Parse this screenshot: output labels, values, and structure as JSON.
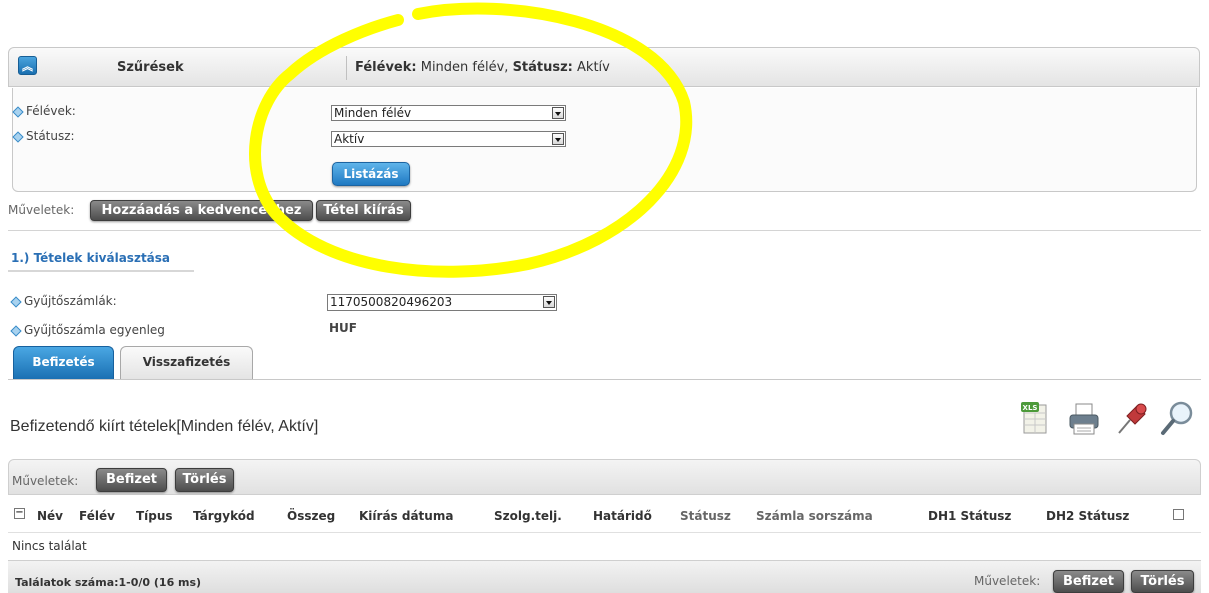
{
  "filters": {
    "title": "Szűrések",
    "summary_semester_label": "Félévek:",
    "summary_semester_value": " Minden félév, ",
    "summary_status_label": "Státusz:",
    "summary_status_value": " Aktív",
    "semester_label": "Félévek:",
    "semester_value": "Minden félév",
    "status_label": "Státusz:",
    "status_value": "Aktív",
    "list_button": "Listázás"
  },
  "operations_top": {
    "label": "Műveletek:",
    "add_favorites": "Hozzáadás a kedvencekhez",
    "print_item": "Tétel kiírás"
  },
  "section": {
    "title": "1.) Tételek kiválasztása",
    "account_label": "Gyűjtőszámlák:",
    "account_value": "1170500820496203",
    "balance_label": "Gyűjtőszámla egyenleg",
    "balance_value": "HUF"
  },
  "tabs": [
    {
      "label": "Befizetés",
      "active": true
    },
    {
      "label": "Visszafizetés",
      "active": false
    }
  ],
  "list": {
    "title": "Befizetendő kiírt tételek[Minden félév, Aktív]",
    "toolbar_icons": [
      "excel-export-icon",
      "print-icon",
      "pin-icon",
      "search-icon"
    ],
    "xls_badge": "XLS"
  },
  "grid": {
    "ops_label": "Műveletek:",
    "pay_button": "Befizet",
    "delete_button": "Törlés",
    "columns": [
      "Név",
      "Félév",
      "Típus",
      "Tárgykód",
      "Összeg",
      "Kiírás dátuma",
      "Szolg.telj.",
      "Határidő",
      "Státusz",
      "Számla sorszáma",
      "DH1 Státusz",
      "DH2 Státusz"
    ],
    "empty_text": "Nincs találat",
    "result_count": "Találatok száma:1-0/0 (16 ms)",
    "bottom_ops_label": "Műveletek:",
    "bottom_pay_button": "Befizet",
    "bottom_delete_button": "Törlés"
  },
  "colors": {
    "accent_blue": "#1f79c2",
    "highlight": "#ffff00"
  }
}
